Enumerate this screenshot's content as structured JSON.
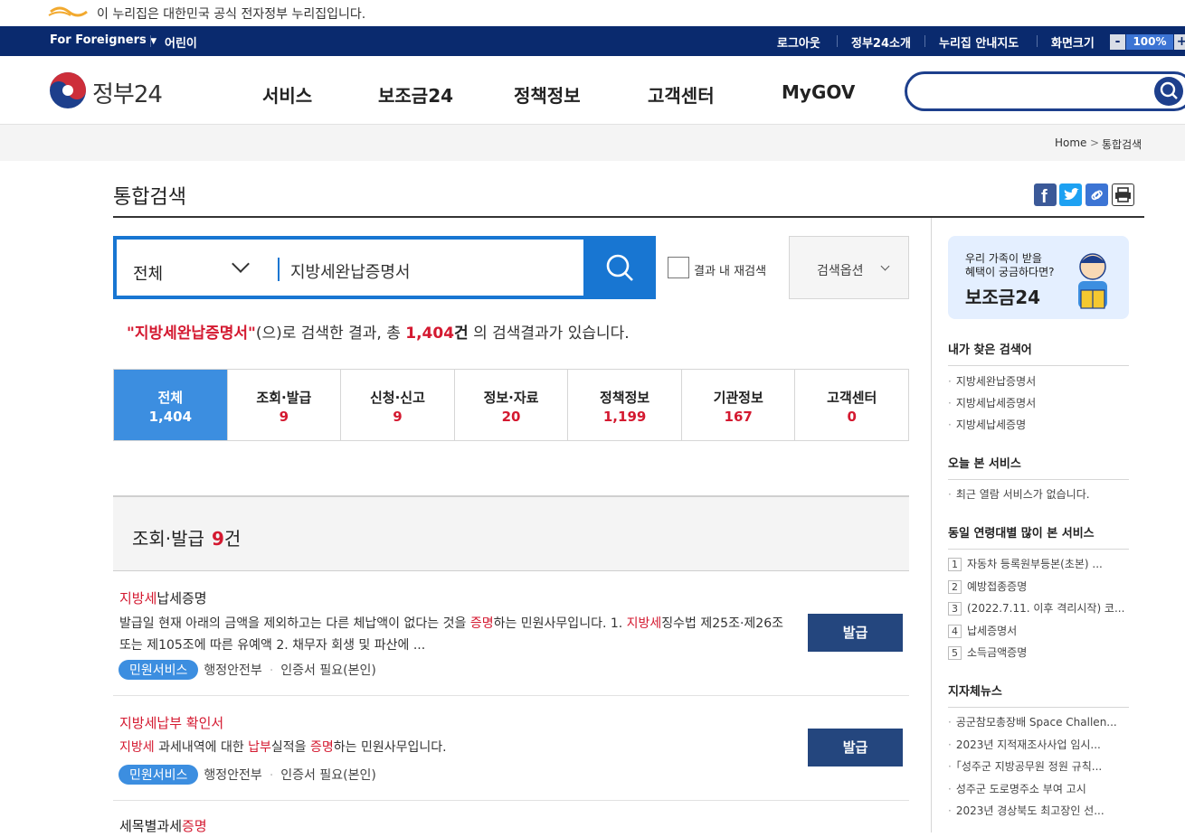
{
  "notice": {
    "text": "이 누리집은 대한민국 공식 전자정부 누리집입니다."
  },
  "util": {
    "foreigners": "For Foreigners",
    "kids": "어린이",
    "logout": "로그아웃",
    "about": "정부24소개",
    "sitemap": "누리집 안내지도",
    "screen_size": "화면크기",
    "zoom_minus": "-",
    "zoom_value": "100%",
    "zoom_plus": "+"
  },
  "header": {
    "brand": "정부24",
    "nav": [
      "서비스",
      "보조금24",
      "정책정보",
      "고객센터",
      "MyGOV"
    ],
    "search_placeholder": ""
  },
  "breadcrumb": {
    "home": "Home",
    "sep": ">",
    "current": "통합검색"
  },
  "page_title": "통합검색",
  "search": {
    "category": "전체",
    "query": "지방세완납증명서",
    "recheck_label": "결과 내 재검색",
    "options_label": "검색옵션"
  },
  "summary": {
    "keyword": "\"지방세완납증명서\"",
    "mid": "(으)로 검색한 결과, 총 ",
    "count": "1,404",
    "unit": "건",
    "tail": " 의 검색결과가 있습니다."
  },
  "tabs": [
    {
      "name": "전체",
      "count": "1,404"
    },
    {
      "name": "조회·발급",
      "count": "9"
    },
    {
      "name": "신청·신고",
      "count": "9"
    },
    {
      "name": "정보·자료",
      "count": "20"
    },
    {
      "name": "정책정보",
      "count": "1,199"
    },
    {
      "name": "기관정보",
      "count": "167"
    },
    {
      "name": "고객센터",
      "count": "0"
    }
  ],
  "section": {
    "title": "조회·발급",
    "count": "9",
    "unit": "건"
  },
  "results": [
    {
      "title_hl": "지방세",
      "title_rest": "납세증명",
      "desc_1": "발급일 현재 아래의 금액을 제외하고는 다른 체납액이 없다는 것을 ",
      "desc_hl_1": "증명",
      "desc_2": "하는 민원사무입니다. 1. ",
      "desc_hl_2": "지방세",
      "desc_3": "징수법 제25조·제26조 또는 제105조에 따른 유예액 2. 채무자 회생 및 파산에 ...",
      "badge": "민원서비스",
      "org": "행정안전부",
      "cert": "인증서 필요(본인)",
      "button": "발급"
    },
    {
      "title_hl": "지방세납부 확인서",
      "desc_hl_1": "지방세",
      "desc_1": " 과세내역에 대한 ",
      "desc_hl_2": "납부",
      "desc_2": "실적을 ",
      "desc_hl_3": "증명",
      "desc_3": "하는 민원사무입니다.",
      "badge": "민원서비스",
      "org": "행정안전부",
      "cert": "인증서 필요(본인)",
      "button": "발급"
    },
    {
      "title_rest": "세목별과세",
      "title_hl": "증명"
    }
  ],
  "sidebar": {
    "banner": {
      "line1": "우리 가족이 받을",
      "line2": "혜택이 궁금하다면?",
      "line3": "보조금24"
    },
    "recent_search_title": "내가 찾은 검색어",
    "recent_search": [
      "지방세완납증명서",
      "지방세납세증명서",
      "지방세납세증명"
    ],
    "today_title": "오늘 본 서비스",
    "today_items": [
      "최근 열람 서비스가 없습니다."
    ],
    "popular_title": "동일 연령대별 많이 본 서비스",
    "popular": [
      {
        "rank": "1",
        "label": "자동차 등록원부등본(초본) ..."
      },
      {
        "rank": "2",
        "label": "예방접종증명"
      },
      {
        "rank": "3",
        "label": "(2022.7.11. 이후 격리시작) 코..."
      },
      {
        "rank": "4",
        "label": "납세증명서"
      },
      {
        "rank": "5",
        "label": "소득금액증명"
      }
    ],
    "news_title": "지자체뉴스",
    "news": [
      "공군참모총장배 Space Challen...",
      "2023년 지적재조사사업 임시...",
      "「성주군 지방공무원 정원 규칙...",
      "성주군 도로명주소 부여 고시",
      "2023년 경상북도 최고장인 선..."
    ]
  },
  "colors": {
    "navy": "#0a2a6e",
    "blue": "#1876d2",
    "tab_active": "#3c8ee0",
    "highlight": "#d41930",
    "button": "#24467e"
  }
}
